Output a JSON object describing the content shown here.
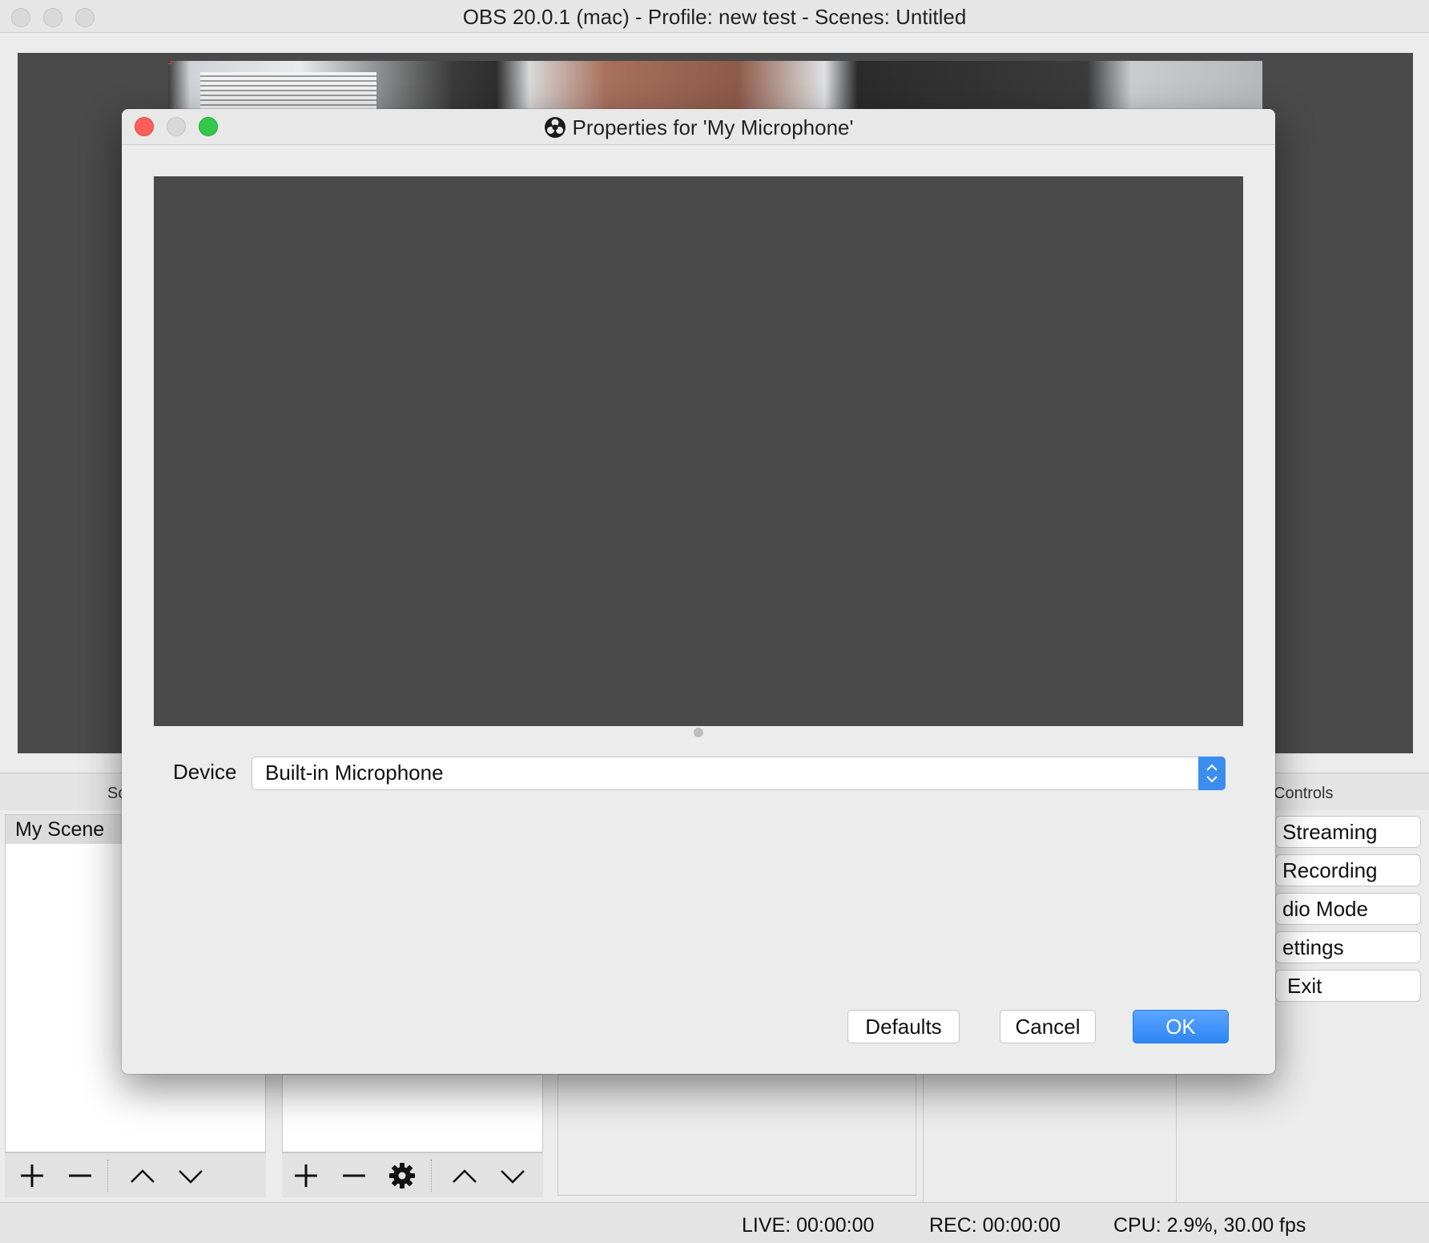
{
  "window": {
    "title": "OBS 20.0.1 (mac) - Profile: new test - Scenes: Untitled"
  },
  "dock": {
    "scenes_label": "Sc",
    "controls_label": "Controls"
  },
  "scenes": {
    "items": [
      "My Scene"
    ]
  },
  "controls": {
    "buttons": [
      "Streaming",
      "Recording",
      "dio Mode",
      "ettings",
      "Exit"
    ]
  },
  "status": {
    "live": "LIVE: 00:00:00",
    "rec": "REC: 00:00:00",
    "cpu": "CPU: 2.9%, 30.00 fps"
  },
  "dialog": {
    "title": "Properties for 'My Microphone'",
    "device_label": "Device",
    "device_value": "Built-in Microphone",
    "defaults_label": "Defaults",
    "cancel_label": "Cancel",
    "ok_label": "OK"
  },
  "colors": {
    "accent": "#3b8df0",
    "close": "#fc5f57",
    "minimize": "#d8d8d8",
    "zoom": "#34c84a",
    "preview_bg": "#4a4a4a"
  }
}
